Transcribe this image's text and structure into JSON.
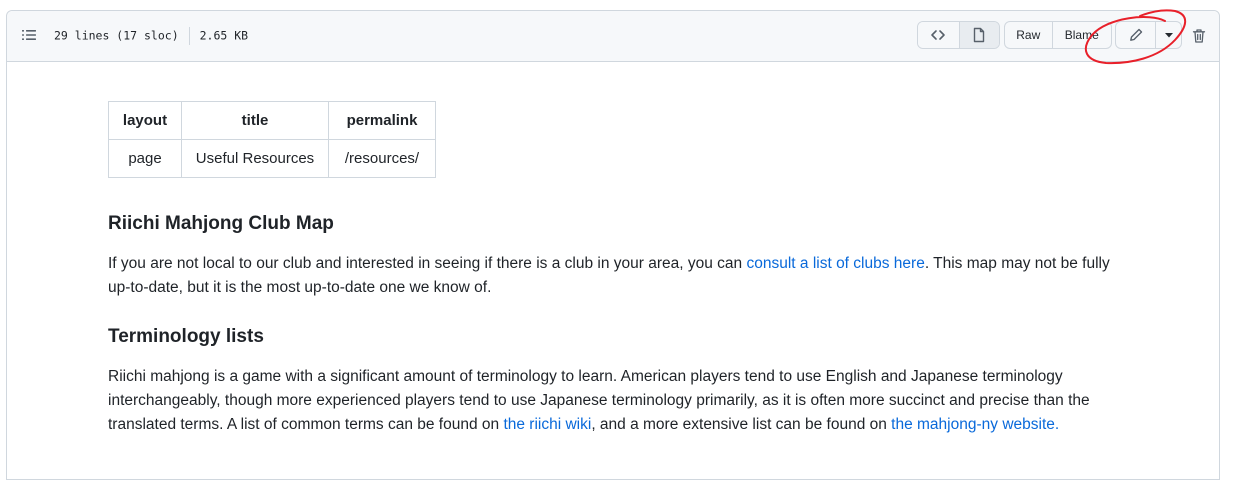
{
  "file_header": {
    "lines_info": "29 lines (17 sloc)",
    "size": "2.65 KB",
    "raw_label": "Raw",
    "blame_label": "Blame"
  },
  "icons": {
    "outline": "list-unordered-icon",
    "code_view": "code-icon",
    "preview": "file-icon",
    "edit": "pencil-icon",
    "more": "triangle-down-icon",
    "delete": "trash-icon"
  },
  "frontmatter_table": {
    "headers": [
      "layout",
      "title",
      "permalink"
    ],
    "row": [
      "page",
      "Useful Resources",
      "/resources/"
    ]
  },
  "sections": {
    "map": {
      "heading": "Riichi Mahjong Club Map",
      "text_before_link": "If you are not local to our club and interested in seeing if there is a club in your area, you can ",
      "link": "consult a list of clubs here",
      "text_after_link": ". This map may not be fully up-to-date, but it is the most up-to-date one we know of."
    },
    "terminology": {
      "heading": "Terminology lists",
      "text_1": "Riichi mahjong is a game with a significant amount of terminology to learn. American players tend to use English and Japanese terminology interchangeably, though more experienced players tend to use Japanese terminology primarily, as it is often more succinct and precise than the translated terms. A list of common terms can be found on ",
      "link_1": "the riichi wiki",
      "text_2": ", and a more extensive list can be found on ",
      "link_2": "the mahjong-ny website."
    }
  },
  "colors": {
    "link": "#0969da",
    "annotation": "#e8202a",
    "header_bg": "#f6f8fa",
    "border": "#d0d7de"
  }
}
